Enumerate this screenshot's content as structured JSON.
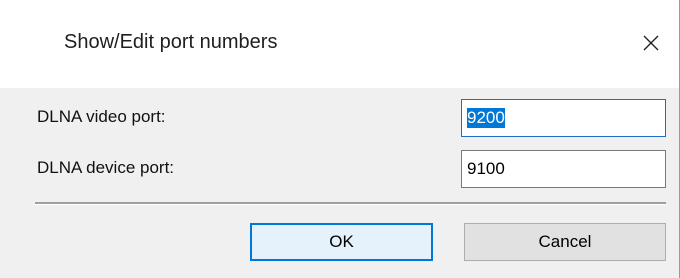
{
  "dialog": {
    "title": "Show/Edit port numbers",
    "close_icon": "close-icon"
  },
  "fields": {
    "video_port": {
      "label": "DLNA video port:",
      "value": "9200",
      "selected": true
    },
    "device_port": {
      "label": "DLNA device port:",
      "value": "9100"
    }
  },
  "buttons": {
    "ok_label": "OK",
    "cancel_label": "Cancel"
  },
  "colors": {
    "dialog_background": "#f0f0f0",
    "titlebar_background": "#ffffff",
    "selection_highlight": "#0078d7",
    "focus_border": "#0078d7",
    "ok_button_fill": "#e5f1fb",
    "cancel_button_fill": "#e1e1e1"
  }
}
